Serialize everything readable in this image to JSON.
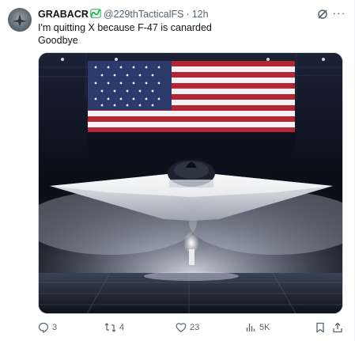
{
  "tweet": {
    "author_name": "GRABACR",
    "handle": "@229thTacticalFS",
    "separator": "·",
    "time": "12h",
    "more_label": "···",
    "text_lines": [
      "I'm quitting X because F-47 is canarded",
      "Goodbye"
    ],
    "media_alt": ""
  },
  "actions": {
    "replies": "3",
    "reposts": "4",
    "likes": "23",
    "views": "5K"
  },
  "icons": {
    "badge": "verified-squiggle-icon",
    "grok": "grok-icon",
    "more": "more-icon",
    "reply": "reply-icon",
    "repost": "repost-icon",
    "like": "heart-icon",
    "views": "views-bar-icon",
    "bookmark": "bookmark-icon",
    "share": "share-icon"
  },
  "colors": {
    "text_primary": "#0f1419",
    "text_secondary": "#536471",
    "badge_green": "#18b54a",
    "border": "#cfd9de"
  }
}
